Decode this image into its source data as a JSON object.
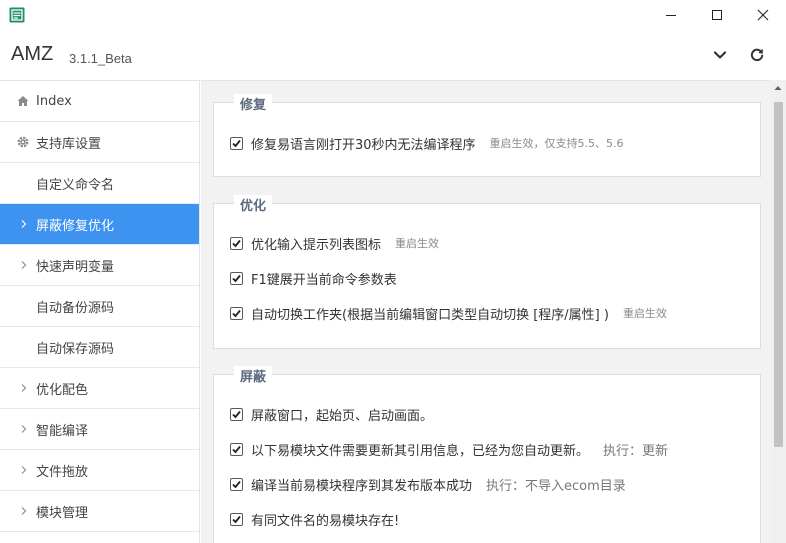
{
  "window": {
    "app_name": "AMZ",
    "version": "3.1.1_Beta"
  },
  "colors": {
    "accent": "#3e93f1",
    "section_title": "#5c6b7d",
    "content_bg": "#f2f2f2"
  },
  "sidebar": {
    "items": [
      {
        "label": "Index",
        "icon": "home-icon"
      },
      {
        "label": "支持库设置",
        "icon": "gear-icon"
      },
      {
        "label": "自定义命令名",
        "icon": ""
      },
      {
        "label": "屏蔽修复优化",
        "icon": "chevron-right-icon",
        "active": true
      },
      {
        "label": "快速声明变量",
        "icon": "chevron-right-icon"
      },
      {
        "label": "自动备份源码",
        "icon": ""
      },
      {
        "label": "自动保存源码",
        "icon": ""
      },
      {
        "label": "优化配色",
        "icon": "chevron-right-icon"
      },
      {
        "label": "智能编译",
        "icon": "chevron-right-icon"
      },
      {
        "label": "文件拖放",
        "icon": "chevron-right-icon"
      },
      {
        "label": "模块管理",
        "icon": "chevron-right-icon"
      }
    ]
  },
  "sections": {
    "fix": {
      "title": "修复",
      "options": [
        {
          "label": "修复易语言刚打开30秒内无法编译程序",
          "note": "重启生效，仅支持5.5、5.6",
          "checked": true
        }
      ]
    },
    "optimize": {
      "title": "优化",
      "options": [
        {
          "label": "优化输入提示列表图标",
          "note": "重启生效",
          "checked": true
        },
        {
          "label": "F1键展开当前命令参数表",
          "note": "",
          "checked": true
        },
        {
          "label": "自动切换工作夹(根据当前编辑窗口类型自动切换 [程序/属性] )",
          "note": "重启生效",
          "checked": true
        }
      ]
    },
    "block": {
      "title": "屏蔽",
      "options": [
        {
          "label": "屏蔽窗口，起始页、启动画面。",
          "note": "",
          "checked": true
        },
        {
          "label": "以下易模块文件需要更新其引用信息，已经为您自动更新。",
          "note": "执行：更新",
          "checked": true
        },
        {
          "label": "编译当前易模块程序到其发布版本成功",
          "note": "执行：不导入ecom目录",
          "checked": true
        },
        {
          "label": "有同文件名的易模块存在!",
          "note": "",
          "checked": true
        }
      ]
    }
  }
}
